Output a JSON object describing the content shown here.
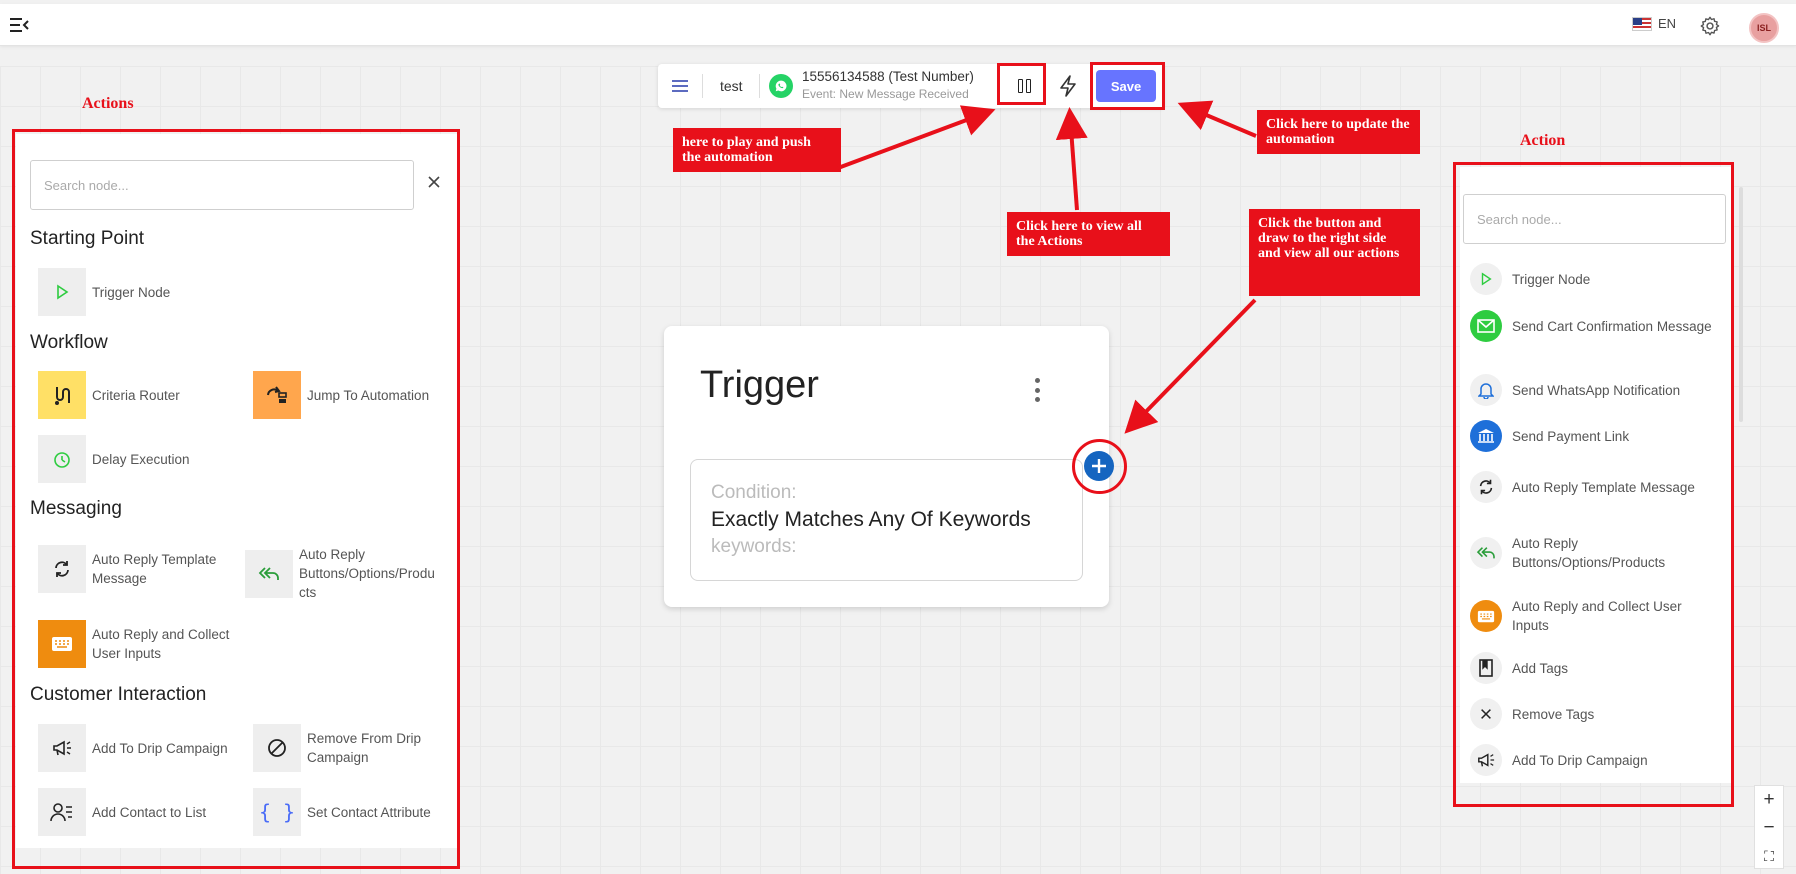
{
  "topbar": {
    "language": "EN",
    "avatar_initials": "ISL"
  },
  "toolbar": {
    "automation_name": "test",
    "phone": "15556134588 (Test Number)",
    "event": "Event: New Message Received",
    "save_label": "Save"
  },
  "left_panel": {
    "title": "Actions",
    "search_placeholder": "Search node...",
    "sections": [
      {
        "heading": "Starting Point",
        "items": [
          "Trigger Node"
        ]
      },
      {
        "heading": "Workflow",
        "items": [
          "Criteria Router",
          "Jump To Automation",
          "Delay Execution"
        ]
      },
      {
        "heading": "Messaging",
        "items": [
          "Auto Reply Template Message",
          "Auto Reply Buttons/Options/Produ cts",
          "Auto Reply and Collect User Inputs"
        ]
      },
      {
        "heading": "Customer Interaction",
        "items": [
          "Add To Drip Campaign",
          "Remove From Drip Campaign",
          "Add Contact to List",
          "Set Contact Attribute"
        ]
      }
    ]
  },
  "trigger_card": {
    "title": "Trigger",
    "condition_label": "Condition:",
    "condition_value": "Exactly Matches Any Of Keywords",
    "keywords_label": "keywords:"
  },
  "right_panel": {
    "title": "Action",
    "search_placeholder": "Search node...",
    "items": [
      "Trigger Node",
      "Send Cart Confirmation Message",
      "Send WhatsApp Notification",
      "Send Payment Link",
      "Auto Reply Template Message",
      "Auto Reply Buttons/Options/Products",
      "Auto Reply and Collect User Inputs",
      "Add Tags",
      "Remove Tags",
      "Add To Drip Campaign"
    ]
  },
  "annotations": {
    "play_push": "here to play and push the automation",
    "view_actions": "Click here to view all the Actions",
    "update": "Click here to update the automation",
    "draw_button": "Click the button and draw to the right side and view all our actions"
  },
  "zoom": {
    "in": "+",
    "out": "−",
    "fit": "⛶"
  },
  "colors": {
    "accent": "#6774ff",
    "annotation_red": "#e8101a",
    "whatsapp_green": "#25d366",
    "plus_blue": "#1565c0"
  }
}
